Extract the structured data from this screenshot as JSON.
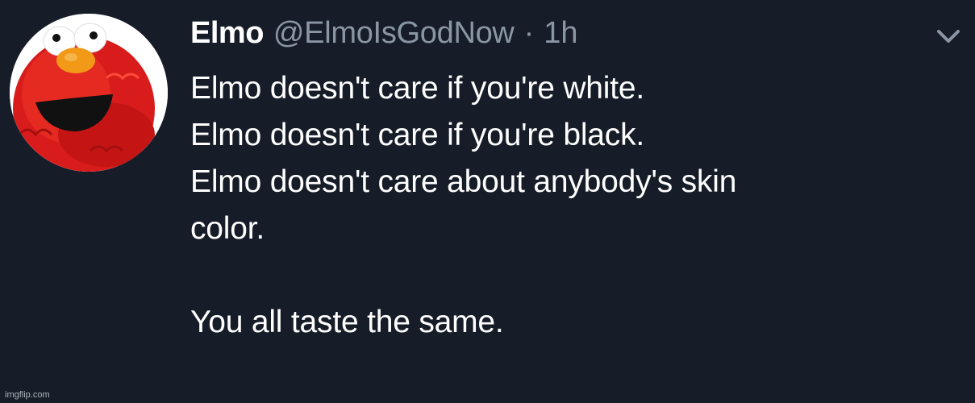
{
  "tweet": {
    "display_name": "Elmo",
    "handle": "@ElmoIsGodNow",
    "separator": "·",
    "time": "1h",
    "lines": [
      "Elmo doesn't care if you're white.",
      "Elmo doesn't care if you're black.",
      "Elmo doesn't care about anybody's skin",
      "color.",
      "You all taste the same."
    ],
    "menu_icon": "chevron-down-icon",
    "avatar_icon": "elmo-avatar"
  },
  "watermark": "imgflip.com",
  "colors": {
    "background": "#161d28",
    "text": "#ffffff",
    "secondary": "#8a96a3"
  }
}
